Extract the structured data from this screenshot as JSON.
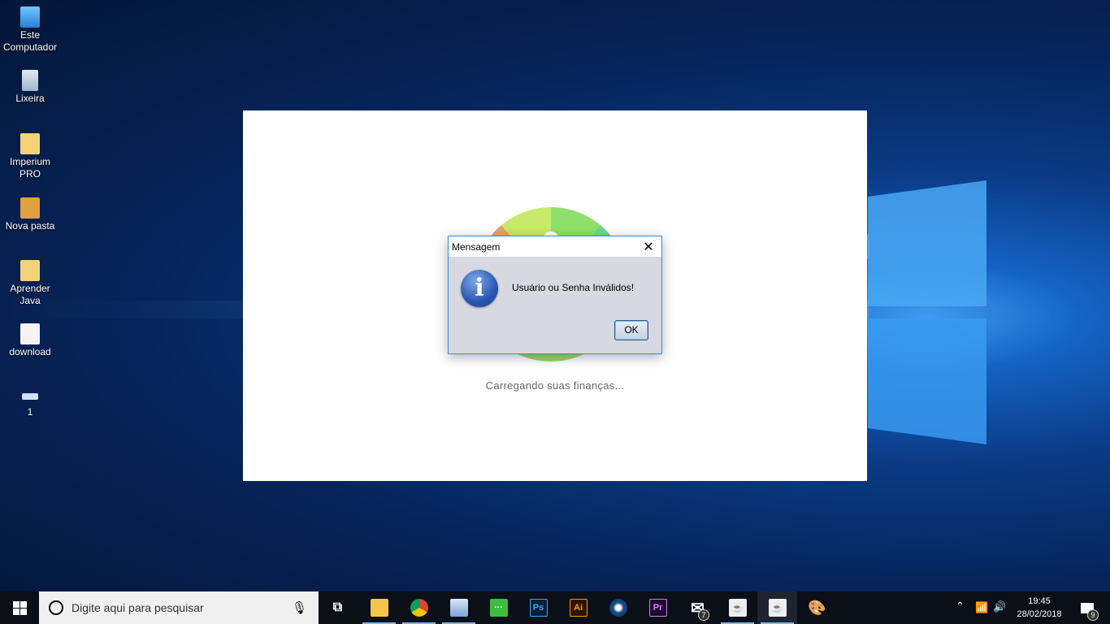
{
  "desktop_icons": [
    {
      "label": "Este Computador",
      "icon": "computer-icon"
    },
    {
      "label": "Lixeira",
      "icon": "recycle-bin-icon"
    },
    {
      "label": "Imperium PRO",
      "icon": "folder-icon"
    },
    {
      "label": "Nova pasta",
      "icon": "folder-icon"
    },
    {
      "label": "Aprender Java",
      "icon": "folder-icon"
    },
    {
      "label": "download",
      "icon": "file-icon"
    },
    {
      "label": "1",
      "icon": "usb-drive-icon"
    }
  ],
  "splash": {
    "loading_text": "Carregando suas finanças..."
  },
  "dialog": {
    "title": "Mensagem",
    "message": "Usuário ou Senha Inválidos!",
    "ok_label": "OK",
    "close_glyph": "✕",
    "icon": "info-icon"
  },
  "taskbar": {
    "search_placeholder": "Digite aqui para pesquisar",
    "apps": [
      {
        "name": "task-view",
        "glyph": "⧉"
      },
      {
        "name": "file-explorer",
        "glyph": ""
      },
      {
        "name": "chrome",
        "glyph": ""
      },
      {
        "name": "virtualbox",
        "glyph": ""
      },
      {
        "name": "app-green",
        "glyph": "···"
      },
      {
        "name": "photoshop",
        "glyph": "Ps"
      },
      {
        "name": "illustrator",
        "glyph": "Ai"
      },
      {
        "name": "steam",
        "glyph": ""
      },
      {
        "name": "premiere",
        "glyph": "Pr"
      },
      {
        "name": "mail",
        "glyph": "✉",
        "badge": "7"
      },
      {
        "name": "java-1",
        "glyph": "☕"
      },
      {
        "name": "java-2",
        "glyph": "☕"
      },
      {
        "name": "paint",
        "glyph": "🎨"
      }
    ],
    "time": "19:45",
    "date": "28/02/2018",
    "notification_count": "9"
  }
}
